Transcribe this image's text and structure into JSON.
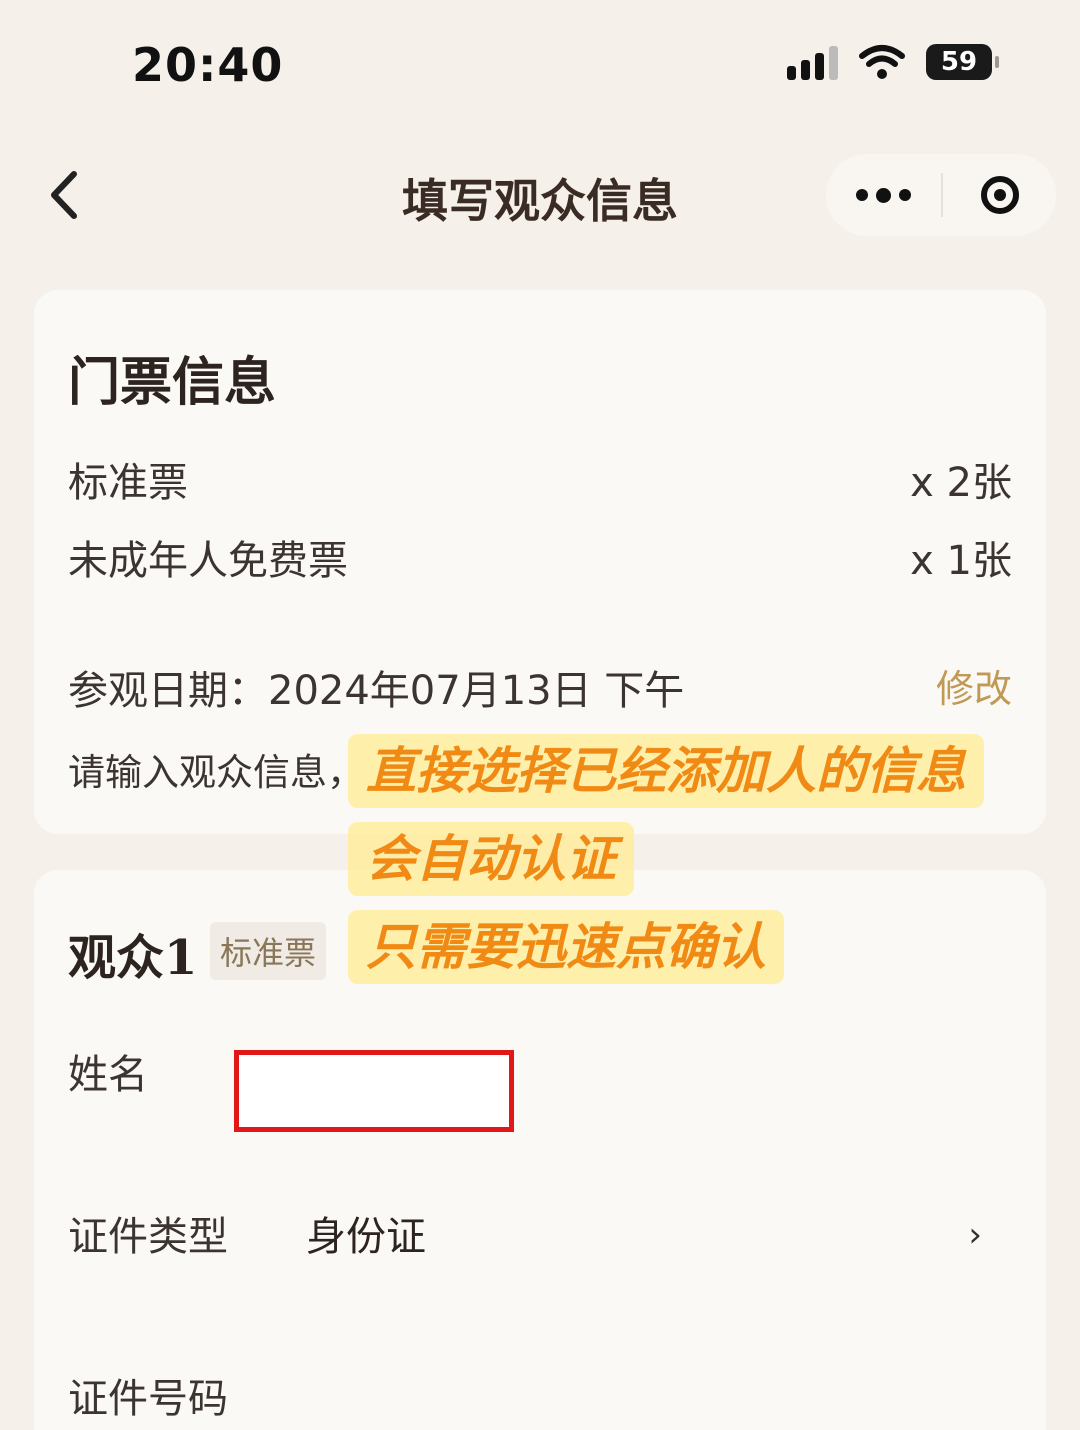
{
  "status_bar": {
    "time": "20:40",
    "battery": "59"
  },
  "nav": {
    "title": "填写观众信息"
  },
  "ticket_info": {
    "title": "门票信息",
    "items": [
      {
        "name": "标准票",
        "qty": "x 2张"
      },
      {
        "name": "未成年人免费票",
        "qty": "x 1张"
      }
    ],
    "visit_date": "参观日期：2024年07月13日   下午",
    "modify_label": "修改",
    "prompt": "请输入观众信息，"
  },
  "visitor": {
    "title": "观众1",
    "badge": "标准票",
    "name_label": "姓名",
    "name_value": "",
    "id_type_label": "证件类型",
    "id_type_value": "身份证",
    "id_number_label": "证件号码"
  },
  "annotations": [
    "直接选择已经添加人的信息",
    "会自动认证",
    "只需要迅速点确认"
  ],
  "colors": {
    "accent": "#c09a55",
    "highlight": "#f08a14",
    "error_box": "#e01818"
  }
}
